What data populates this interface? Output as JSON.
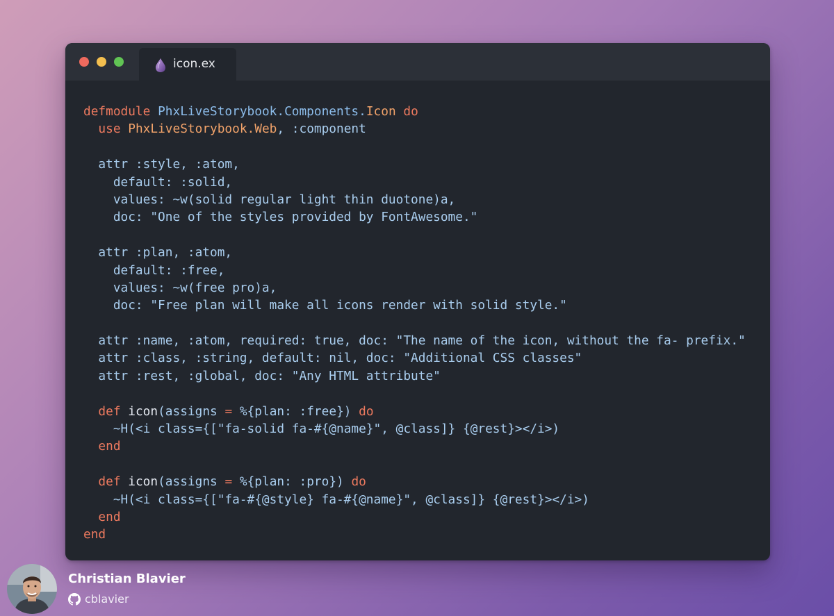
{
  "window": {
    "tab_label": "icon.ex",
    "tab_icon": "elixir-drop-icon"
  },
  "colors": {
    "keyword": "#ee7a5f",
    "module": "#8cbcea",
    "module_last": "#f2a36a",
    "text": "#a9cdee",
    "function": "#e4e8f0",
    "editor_bg": "#22262d"
  },
  "code_lines": [
    [
      [
        "kw",
        "defmodule"
      ],
      [
        "p",
        " "
      ],
      [
        "mod",
        "PhxLiveStorybook.Components."
      ],
      [
        "cls",
        "Icon"
      ],
      [
        "p",
        " "
      ],
      [
        "kw",
        "do"
      ]
    ],
    [
      [
        "p",
        "  "
      ],
      [
        "kw",
        "use"
      ],
      [
        "p",
        " "
      ],
      [
        "cls",
        "PhxLiveStorybook.Web"
      ],
      [
        "p",
        ", :component"
      ]
    ],
    [],
    [
      [
        "p",
        "  attr :style, :atom,"
      ]
    ],
    [
      [
        "p",
        "    default: :solid,"
      ]
    ],
    [
      [
        "p",
        "    values: ~w(solid regular light thin duotone)a,"
      ]
    ],
    [
      [
        "p",
        "    doc: \"One of the styles provided by FontAwesome.\""
      ]
    ],
    [],
    [
      [
        "p",
        "  attr :plan, :atom,"
      ]
    ],
    [
      [
        "p",
        "    default: :free,"
      ]
    ],
    [
      [
        "p",
        "    values: ~w(free pro)a,"
      ]
    ],
    [
      [
        "p",
        "    doc: \"Free plan will make all icons render with solid style.\""
      ]
    ],
    [],
    [
      [
        "p",
        "  attr :name, :atom, required: true, doc: \"The name of the icon, without the fa- prefix.\""
      ]
    ],
    [
      [
        "p",
        "  attr :class, :string, default: nil, doc: \"Additional CSS classes\""
      ]
    ],
    [
      [
        "p",
        "  attr :rest, :global, doc: \"Any HTML attribute\""
      ]
    ],
    [],
    [
      [
        "p",
        "  "
      ],
      [
        "kw",
        "def"
      ],
      [
        "p",
        " "
      ],
      [
        "fn",
        "icon"
      ],
      [
        "p",
        "(assigns "
      ],
      [
        "kw",
        "="
      ],
      [
        "p",
        " %{plan: :free}) "
      ],
      [
        "kw",
        "do"
      ]
    ],
    [
      [
        "p",
        "    ~H(<i class={[\"fa-solid fa-#{@name}\", @class]} {@rest}></i>)"
      ]
    ],
    [
      [
        "p",
        "  "
      ],
      [
        "kw",
        "end"
      ]
    ],
    [],
    [
      [
        "p",
        "  "
      ],
      [
        "kw",
        "def"
      ],
      [
        "p",
        " "
      ],
      [
        "fn",
        "icon"
      ],
      [
        "p",
        "(assigns "
      ],
      [
        "kw",
        "="
      ],
      [
        "p",
        " %{plan: :pro}) "
      ],
      [
        "kw",
        "do"
      ]
    ],
    [
      [
        "p",
        "    ~H(<i class={[\"fa-#{@style} fa-#{@name}\", @class]} {@rest}></i>)"
      ]
    ],
    [
      [
        "p",
        "  "
      ],
      [
        "kw",
        "end"
      ]
    ],
    [
      [
        "kw",
        "end"
      ]
    ]
  ],
  "author": {
    "name": "Christian Blavier",
    "handle": "cblavier",
    "handle_icon": "github-icon",
    "avatar_icon": "avatar"
  }
}
